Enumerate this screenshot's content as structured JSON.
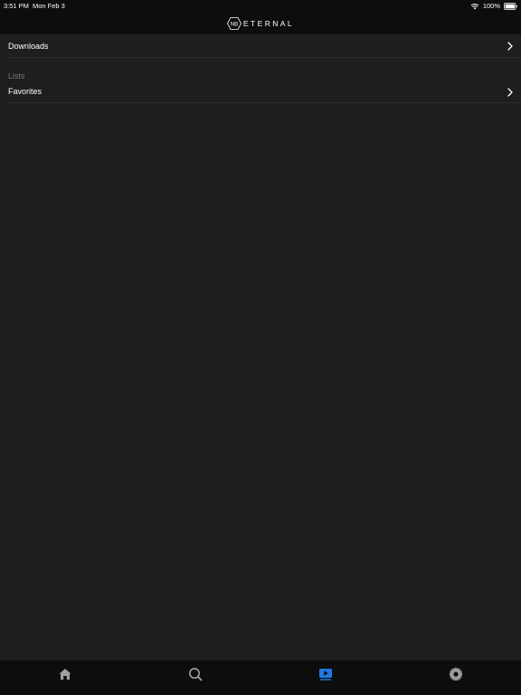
{
  "status_bar": {
    "time": "3:51 PM",
    "date": "Mon Feb 3",
    "battery": "100%"
  },
  "header": {
    "logo_mark": "NB",
    "logo_text": "ETERNAL"
  },
  "library": {
    "downloads_label": "Downloads",
    "lists_section_label": "Lists",
    "favorites_label": "Favorites"
  },
  "tab_bar": {
    "tabs": [
      {
        "icon": "home-icon",
        "active": false
      },
      {
        "icon": "search-icon",
        "active": false
      },
      {
        "icon": "play-library-icon",
        "active": true
      },
      {
        "icon": "settings-gear-icon",
        "active": false
      }
    ]
  },
  "colors": {
    "background": "#1e1e1e",
    "bars": "#0d0d0d",
    "accent": "#1f7ae0",
    "inactive_icon": "#a0a0a0",
    "section_label": "#7a7a7a"
  }
}
